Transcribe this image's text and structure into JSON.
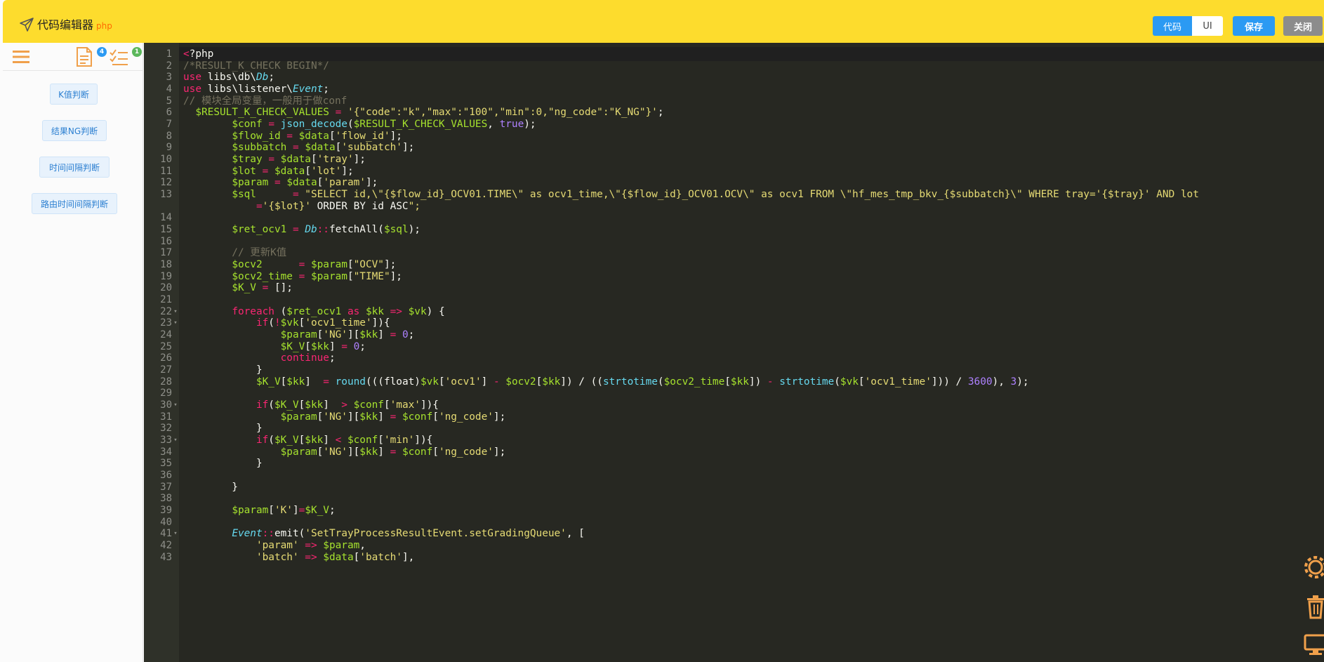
{
  "header": {
    "title": "代码编辑器",
    "subtitle": "php",
    "code_toggle_label": "代码",
    "ui_toggle_label": "UI",
    "save_label": "保存",
    "close_label": "关闭"
  },
  "sidebar": {
    "file_badge": "4",
    "check_badge": "1",
    "items": [
      {
        "label": "K值判断"
      },
      {
        "label": "结果NG判断"
      },
      {
        "label": "时间间隔判断"
      },
      {
        "label": "路由时间间隔判断"
      }
    ]
  },
  "editor": {
    "line_numbers": [
      "1",
      "2",
      "3",
      "4",
      "5",
      "6",
      "7",
      "8",
      "9",
      "10",
      "11",
      "12",
      "13",
      "",
      "14",
      "15",
      "16",
      "17",
      "18",
      "19",
      "20",
      "21",
      "22",
      "23",
      "24",
      "25",
      "26",
      "27",
      "28",
      "29",
      "30",
      "31",
      "32",
      "33",
      "34",
      "35",
      "36",
      "37",
      "38",
      "39",
      "40",
      "41",
      "42",
      "43"
    ],
    "lines": [
      "<?php",
      "/*RESULT_K_CHECK BEGIN*/",
      "use libs\\db\\Db;",
      "use libs\\listener\\Event;",
      "// 模块全局变量，一般用于做conf",
      "  $RESULT_K_CHECK_VALUES = '{\"code\":\"k\",\"max\":\"100\",\"min\":0,\"ng_code\":\"K_NG\"}';",
      "        $conf = json_decode($RESULT_K_CHECK_VALUES, true);",
      "        $flow_id = $data['flow_id'];",
      "        $subbatch = $data['subbatch'];",
      "        $tray = $data['tray'];",
      "        $lot = $data['lot'];",
      "        $param = $data['param'];",
      "        $sql      = \"SELECT id,\\\"{$flow_id}_OCV01.TIME\\\" as ocv1_time,\\\"{$flow_id}_OCV01.OCV\\\" as ocv1 FROM \\\"hf_mes_tmp_bkv_{$subbatch}\\\" WHERE tray='{$tray}' AND lot",
      "            ='{$lot}' ORDER BY id ASC\";",
      "",
      "        $ret_ocv1 = Db::fetchAll($sql);",
      "",
      "        // 更新K值",
      "        $ocv2      = $param[\"OCV\"];",
      "        $ocv2_time = $param[\"TIME\"];",
      "        $K_V = [];",
      "",
      "        foreach ($ret_ocv1 as $kk => $vk) {",
      "            if(!$vk['ocv1_time']){",
      "                $param['NG'][$kk] = 0;",
      "                $K_V[$kk] = 0;",
      "                continue;",
      "            }",
      "            $K_V[$kk]  = round(((float)$vk['ocv1'] - $ocv2[$kk]) / ((strtotime($ocv2_time[$kk]) - strtotime($vk['ocv1_time'])) / 3600), 3);",
      "",
      "            if($K_V[$kk]  > $conf['max']){",
      "                $param['NG'][$kk] = $conf['ng_code'];",
      "            }",
      "            if($K_V[$kk] < $conf['min']){",
      "                $param['NG'][$kk] = $conf['ng_code'];",
      "            }",
      "",
      "        }",
      "",
      "        $param['K']=$K_V;",
      "",
      "        Event::emit('SetTrayProcessResultEvent.setGradingQueue', [",
      "            'param' => $param,",
      "            'batch' => $data['batch'],"
    ]
  },
  "colors": {
    "header_bg": "#fddc2d",
    "accent": "#2b9af3",
    "editor_bg": "#272822"
  }
}
